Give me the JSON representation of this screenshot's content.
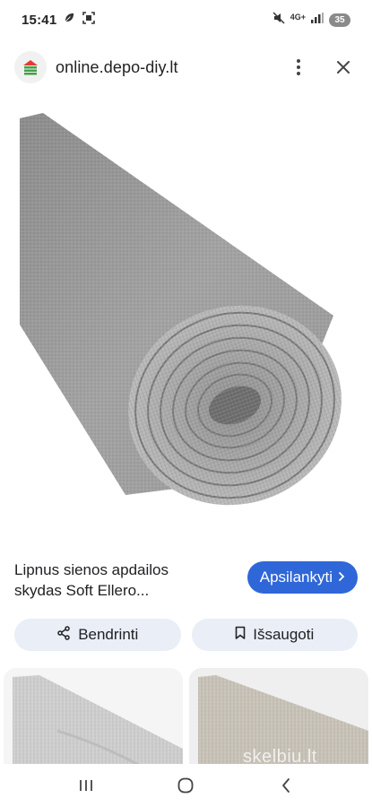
{
  "status_bar": {
    "time": "15:41",
    "network": "4G+",
    "battery": "35",
    "icons": [
      "leaf-icon",
      "screenshot-icon",
      "mute-icon",
      "signal-icon"
    ]
  },
  "header": {
    "url": "online.depo-diy.lt",
    "logo_icon": "house-logo-icon",
    "more_icon": "more-vert-icon",
    "close_icon": "close-icon"
  },
  "product": {
    "title": "Lipnus sienos apdailos skydas Soft Ellero...",
    "visit_label": "Apsilankyti",
    "visit_icon": "chevron-right-icon"
  },
  "actions": {
    "share_label": "Bendrinti",
    "save_label": "Išsaugoti"
  },
  "related": {
    "watermark": "skelbiu.lt"
  },
  "nav": {
    "recents_icon": "recents-icon",
    "home_icon": "home-icon",
    "back_icon": "back-icon"
  },
  "colors": {
    "accent": "#2f67d8",
    "chip_bg": "#e9eef7",
    "logo_red": "#e53935",
    "logo_green": "#43a047"
  }
}
